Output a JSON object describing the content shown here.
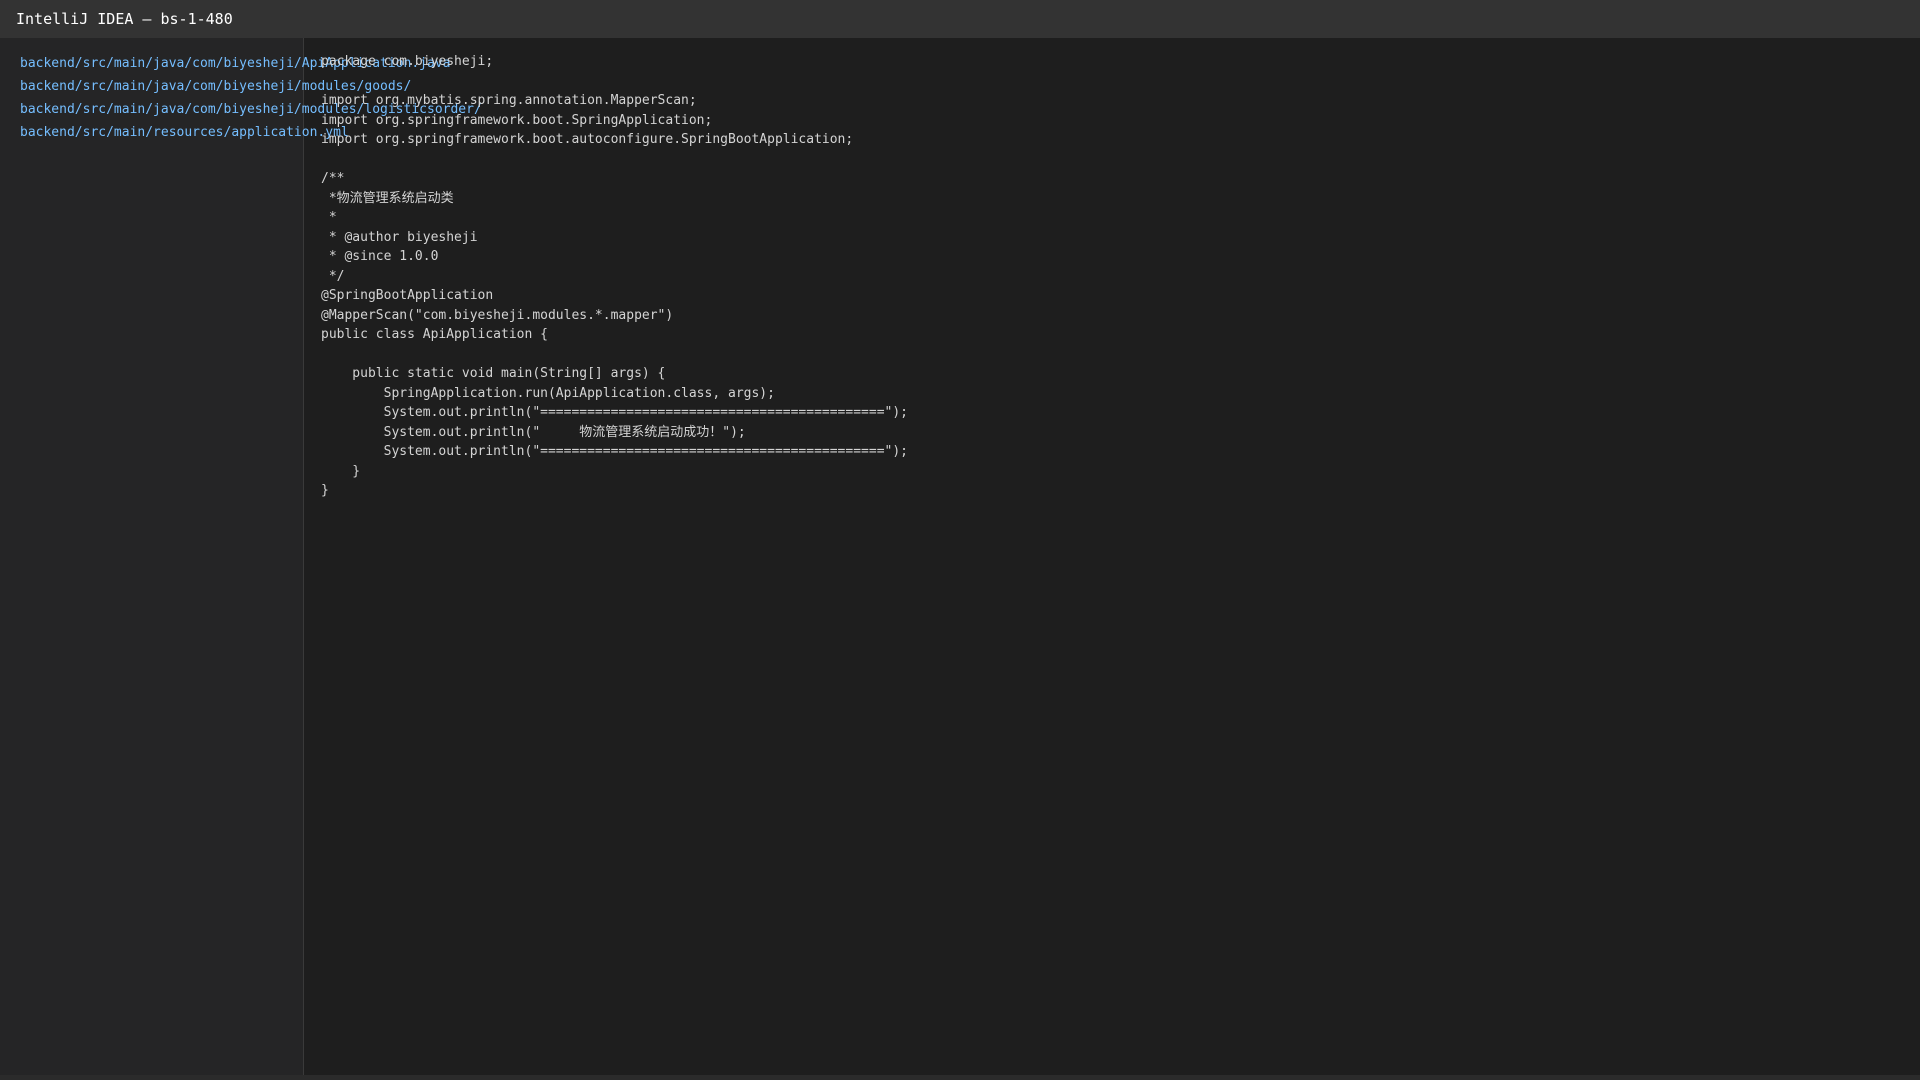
{
  "window": {
    "title": "IntelliJ IDEA — bs-1-480"
  },
  "sidebar": {
    "files": [
      "backend/src/main/java/com/biyesheji/ApiApplication.java",
      "backend/src/main/java/com/biyesheji/modules/goods/",
      "backend/src/main/java/com/biyesheji/modules/logisticsorder/",
      "backend/src/main/resources/application.yml"
    ]
  },
  "editor": {
    "lines": [
      "package com.biyesheji;",
      "",
      "import org.mybatis.spring.annotation.MapperScan;",
      "import org.springframework.boot.SpringApplication;",
      "import org.springframework.boot.autoconfigure.SpringBootApplication;",
      "",
      "/**",
      " *物流管理系统启动类",
      " *",
      " * @author biyesheji",
      " * @since 1.0.0",
      " */",
      "@SpringBootApplication",
      "@MapperScan(\"com.biyesheji.modules.*.mapper\")",
      "public class ApiApplication {",
      "",
      "    public static void main(String[] args) {",
      "        SpringApplication.run(ApiApplication.class, args);",
      "        System.out.println(\"============================================\");",
      "        System.out.println(\"     物流管理系统启动成功！\");",
      "        System.out.println(\"============================================\");",
      "    }",
      "}"
    ]
  },
  "colors": {
    "title_bar_bg": "#333333",
    "sidebar_bg": "#252526",
    "editor_bg": "#1e1e1e",
    "file_link": "#75beff",
    "code_text": "#d4d4d4"
  }
}
